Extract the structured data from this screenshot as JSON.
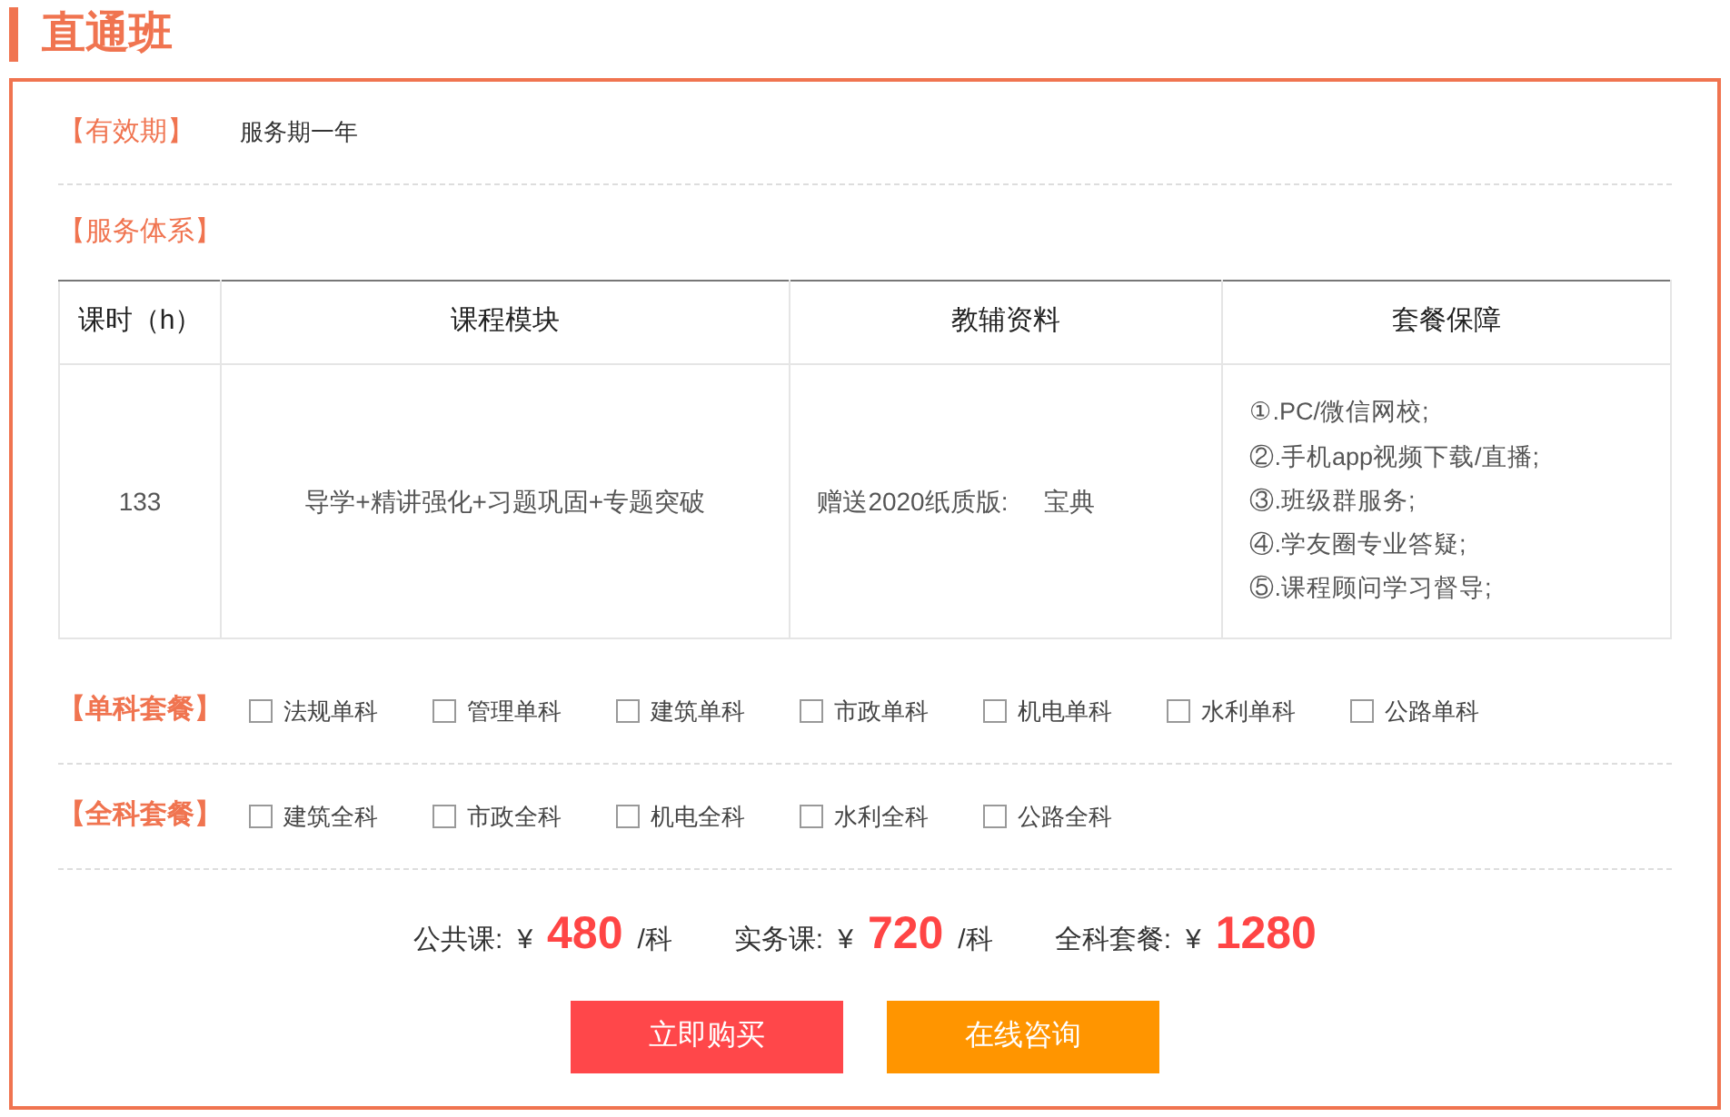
{
  "title": "直通班",
  "validity": {
    "label": "【有效期】",
    "value": "服务期一年"
  },
  "service": {
    "label": "【服务体系】",
    "table": {
      "columns": [
        "课时（h）",
        "课程模块",
        "教辅资料",
        "套餐保障"
      ],
      "rows": [
        {
          "hours": "133",
          "modules": "导学+精讲强化+习题巩固+专题突破",
          "materials": [
            "赠送2020纸质版:",
            "宝典"
          ],
          "guarantees": [
            "①.PC/微信网校;",
            "②.手机app视频下载/直播;",
            "③.班级群服务;",
            "④.学友圈专业答疑;",
            "⑤.课程顾问学习督导;"
          ]
        }
      ]
    }
  },
  "packages": [
    {
      "label": "【单科套餐】",
      "options": [
        {
          "label": "法规单科",
          "checked": false
        },
        {
          "label": "管理单科",
          "checked": false
        },
        {
          "label": "建筑单科",
          "checked": false
        },
        {
          "label": "市政单科",
          "checked": false
        },
        {
          "label": "机电单科",
          "checked": false
        },
        {
          "label": "水利单科",
          "checked": false
        },
        {
          "label": "公路单科",
          "checked": false
        }
      ]
    },
    {
      "label": "【全科套餐】",
      "options": [
        {
          "label": "建筑全科",
          "checked": false
        },
        {
          "label": "市政全科",
          "checked": false
        },
        {
          "label": "机电全科",
          "checked": false
        },
        {
          "label": "水利全科",
          "checked": false
        },
        {
          "label": "公路全科",
          "checked": false
        }
      ]
    }
  ],
  "prices": [
    {
      "label": "公共课:",
      "currency": "¥",
      "amount": "480",
      "unit": "/科"
    },
    {
      "label": "实务课:",
      "currency": "¥",
      "amount": "720",
      "unit": "/科"
    },
    {
      "label": "全科套餐:",
      "currency": "¥",
      "amount": "1280"
    }
  ],
  "buttons": [
    {
      "label": "立即购买",
      "kind": "primary"
    },
    {
      "label": "在线咨询",
      "kind": "secondary"
    }
  ]
}
